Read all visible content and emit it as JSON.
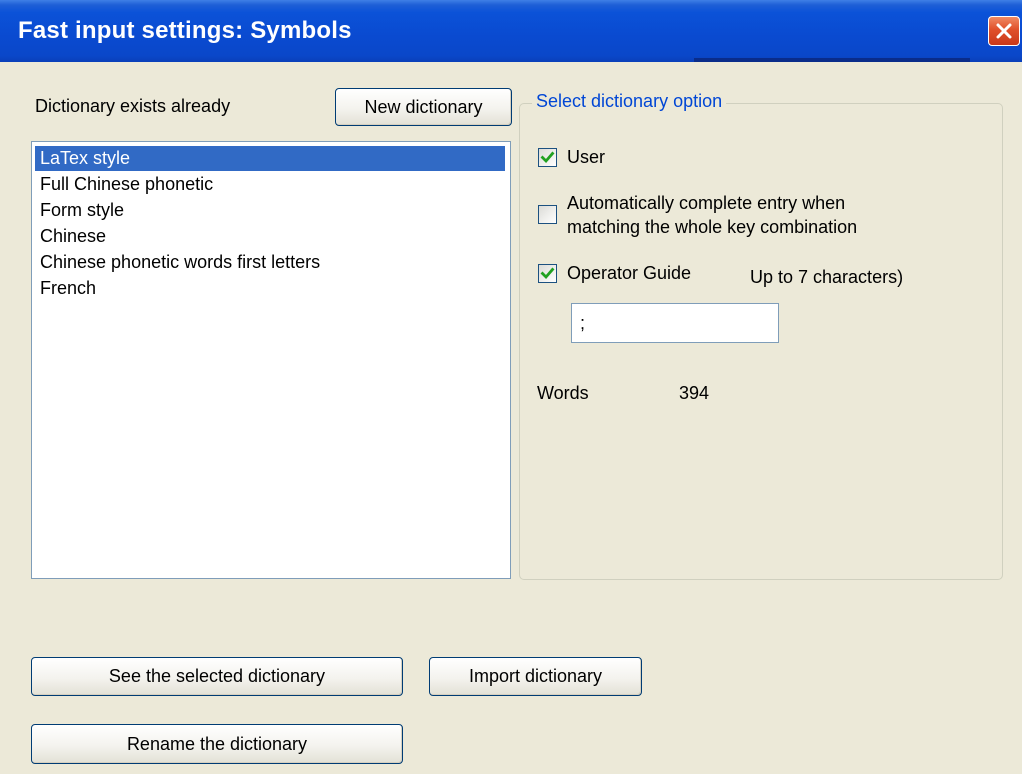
{
  "window": {
    "title": "Fast input settings: Symbols"
  },
  "left": {
    "existing_label": "Dictionary exists already",
    "new_button": "New dictionary",
    "dictionaries": [
      {
        "label": "LaTex style",
        "selected": true
      },
      {
        "label": "Full Chinese phonetic",
        "selected": false
      },
      {
        "label": "Form style",
        "selected": false
      },
      {
        "label": "Chinese",
        "selected": false
      },
      {
        "label": "Chinese phonetic words first letters",
        "selected": false
      },
      {
        "label": "French",
        "selected": false
      }
    ]
  },
  "options": {
    "group_label": "Select dictionary option",
    "user": {
      "label": "User",
      "checked": true
    },
    "auto_complete": {
      "label_line1": "Automatically complete entry when",
      "label_line2": "matching the whole key combination",
      "checked": false
    },
    "operator_guide": {
      "label": "Operator Guide",
      "checked": true,
      "hint": "Up to 7 characters)"
    },
    "guide_value": ";",
    "words_label": "Words",
    "words_count": "394"
  },
  "buttons": {
    "see_selected": "See the selected dictionary",
    "import": "Import dictionary",
    "rename": "Rename the dictionary"
  },
  "colors": {
    "title_bar": "#0a4ad0",
    "selection": "#316ac5",
    "group_label": "#0046d5",
    "close_button": "#e0502a",
    "window_bg": "#ece9d8"
  },
  "icons": {
    "close": "close-icon",
    "check": "checkmark-icon"
  }
}
